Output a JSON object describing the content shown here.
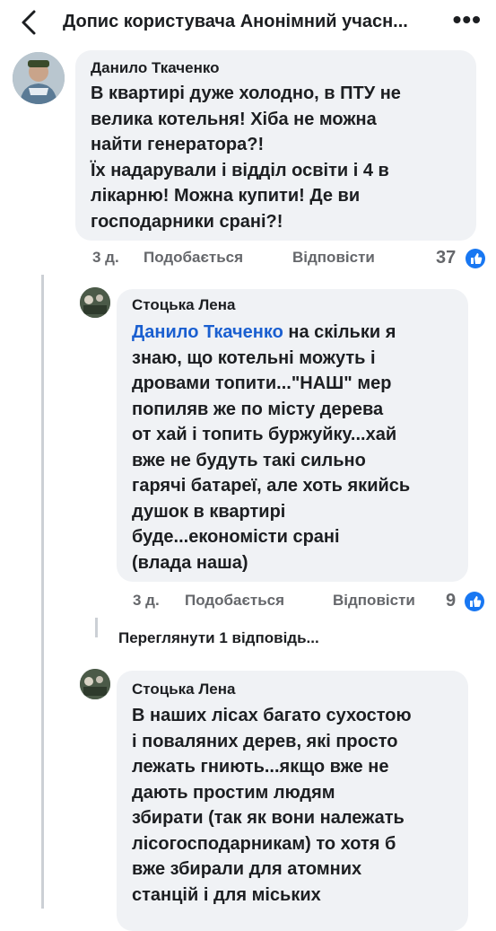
{
  "header": {
    "title": "Допис користувача Анонімний учасн..."
  },
  "comments": [
    {
      "author": "Данило Ткаченко",
      "text": "В квартирі дуже холодно, в ПТУ не\nвелика котельня! Хіба не можна\nнайти генератора?!\nЇх надарували і відділ освіти і 4 в\nлікарню! Можна купити! Де ви\nгосподарники срані?!",
      "time": "3 д.",
      "like_label": "Подобається",
      "reply_label": "Відповісти",
      "reactions": "37"
    },
    {
      "author": "Стоцька Лена",
      "mention": "Данило Ткаченко",
      "text_after_mention": " на скільки я\nзнаю, що котельні можуть і\nдровами топити...\"НАШ\" мер\nпопиляв же по місту дерева\nот хай і топить буржуйку...хай\nвже не будуть такі сильно\nгарячі батареї, але хоть якийсь\nдушок в квартирі\nбуде...економісти срані\n(влада наша)",
      "time": "3 д.",
      "like_label": "Подобається",
      "reply_label": "Відповісти",
      "reactions": "9"
    },
    {
      "author": "Стоцька Лена",
      "text": "В наших лісах багато сухостою\nі поваляних дерев, які просто\nлежать гниють...якщо вже не\nдають простим людям\nзбирати (так як вони належать\nлісогосподарникам) то хотя б\nвже збирали для атомних\nстанцій і для міських"
    }
  ],
  "view_replies": "Переглянути 1 відповідь...",
  "colors": {
    "bubble": "#f0f2f5",
    "mention": "#1a5fd0",
    "like_badge": "#1877f2",
    "meta": "#65676b"
  }
}
